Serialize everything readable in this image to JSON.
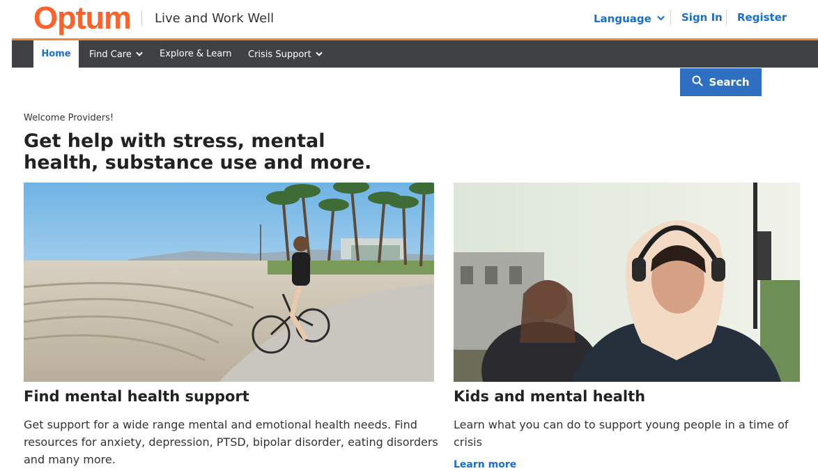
{
  "header": {
    "logo_text": "Optum",
    "tagline": "Live and Work Well",
    "language_label": "Language",
    "sign_in_label": "Sign In",
    "register_label": "Register"
  },
  "nav": {
    "items": [
      {
        "label": "Home",
        "active": true
      },
      {
        "label": "Find Care",
        "has_dropdown": true
      },
      {
        "label": "Explore & Learn"
      },
      {
        "label": "Crisis Support",
        "has_dropdown": true
      }
    ]
  },
  "search": {
    "label": "Search",
    "icon": "search-icon"
  },
  "hero": {
    "welcome": "Welcome Providers!",
    "headline_line1": "Get help with stress, mental",
    "headline_line2": "health, substance use and more."
  },
  "cards": [
    {
      "title": "Find mental health support",
      "desc_lines": [
        "Get support for a wide range mental and emotional health needs.  Find",
        "resources for anxiety, depression, PTSD, bipolar disorder, eating disorders",
        "and many more."
      ]
    },
    {
      "title": "Kids and mental health",
      "desc_lines": [
        "Learn what you can do to support young people in a time of",
        "crisis"
      ],
      "link_label": "Learn more"
    }
  ],
  "colors": {
    "brand_orange": "#ff612b",
    "accent_line": "#f28a33",
    "link_blue": "#196ecf",
    "nav_bg": "#3f4144",
    "search_bg": "#2e6fc1"
  }
}
